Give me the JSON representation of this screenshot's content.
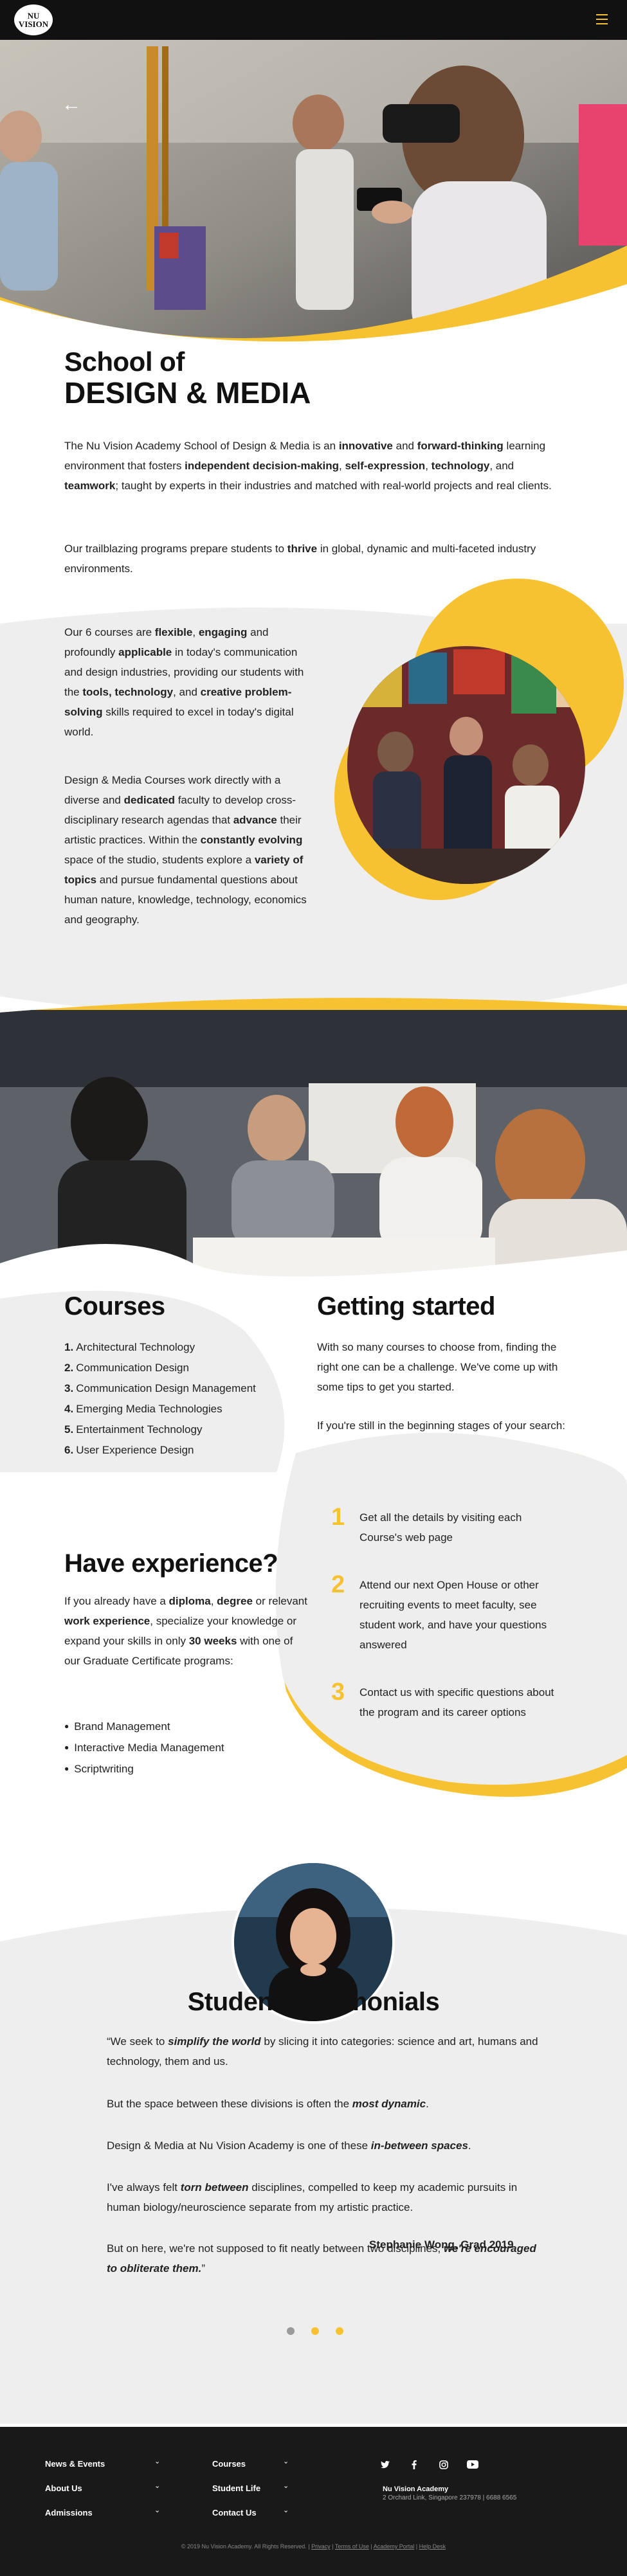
{
  "brand": {
    "logo_line1": "NU",
    "logo_line2": "VISION",
    "accent": "#f7c232",
    "dark": "#111111",
    "grey": "#eeeeee"
  },
  "header": {
    "menu_icon": "hamburger-icon"
  },
  "hero": {
    "back_icon": "arrow-left-icon",
    "back_glyph": "←"
  },
  "intro": {
    "title_line1": "School of",
    "title_line2": "DESIGN & MEDIA",
    "p1": {
      "a": "The Nu Vision Academy School of Design & Media is an ",
      "b": "innovative",
      "c": " and ",
      "d": "forward-thinking",
      "e": " learning environment that fosters ",
      "f": "independent decision-making",
      "g": ", ",
      "h": "self-expression",
      "i": ", ",
      "j": "technology",
      "k": ", and ",
      "l": "teamwork",
      "m": "; taught by experts in their industries and matched with real-world projects and real clients."
    },
    "p2": {
      "a": "Our trailblazing programs prepare students to ",
      "b": "thrive",
      "c": " in global, dynamic and multi-faceted industry environments."
    }
  },
  "features": {
    "p1": {
      "a": "Our 6 courses are ",
      "b": "flexible",
      "c": ", ",
      "d": "engaging",
      "e": " and profoundly ",
      "f": "applicable",
      "g": " in today's communication and design industries, providing our students with the ",
      "h": "tools, technology",
      "i": ", and ",
      "j": "creative problem-solving",
      "k": " skills required to excel in today's digital world."
    },
    "p2": {
      "a": "Design & Media Courses work directly with a diverse and ",
      "b": "dedicated",
      "c": " faculty to develop cross-disciplinary research agendas that ",
      "d": "advance",
      "e": " their artistic practices. Within the ",
      "f": "constantly evolving",
      "g": " space of the studio, students explore a ",
      "h": "variety of topics",
      "i": " and pursue fundamental questions about human nature, knowledge, technology, economics and geography."
    }
  },
  "courses": {
    "title": "Courses",
    "items": [
      {
        "num": "1.",
        "label": "Architectural Technology"
      },
      {
        "num": "2.",
        "label": "Communication Design"
      },
      {
        "num": "3.",
        "label": "Communication Design Management"
      },
      {
        "num": "4.",
        "label": "Emerging Media Technologies"
      },
      {
        "num": "5.",
        "label": "Entertainment Technology"
      },
      {
        "num": "6.",
        "label": "User Experience Design"
      }
    ]
  },
  "getting_started": {
    "title": "Getting started",
    "p1": "With so many courses to choose from, finding the right one can be a challenge. We've come up with some tips to get you started.",
    "p2": "If you're still in the beginning stages of your search:",
    "steps": [
      {
        "num": "1",
        "text": "Get all the details by visiting each Course's web page"
      },
      {
        "num": "2",
        "text": "Attend our next Open House or other recruiting events to meet faculty, see student work, and have your questions answered"
      },
      {
        "num": "3",
        "text": "Contact us with specific questions about the program and its career options"
      }
    ]
  },
  "experience": {
    "title": "Have experience?",
    "p": {
      "a": "If you already have a ",
      "b": "diploma",
      "c": ", ",
      "d": "degree",
      "e": " or relevant ",
      "f": "work experience",
      "g": ", specialize your knowledge or expand your skills in only ",
      "h": "30 weeks",
      "i": " with one of our Graduate Certificate programs:"
    },
    "items": [
      "Brand Management",
      "Interactive Media Management",
      "Scriptwriting"
    ]
  },
  "testimonials": {
    "title": "Student Testimonials",
    "q1": {
      "a": "“We seek to ",
      "b": "simplify the world",
      "c": " by slicing it into categories: science and art, humans and technology, them and us."
    },
    "q2": {
      "a": "But the space between these divisions is often the ",
      "b": "most dynamic",
      "c": "."
    },
    "q3": {
      "a": "Design & Media at Nu Vision Academy is one of these ",
      "b": "in-between spaces",
      "c": "."
    },
    "q4": {
      "a": "I've always felt ",
      "b": "torn between",
      "c": " disciplines, compelled to keep my academic pursuits in human biology/neuroscience separate from my artistic practice."
    },
    "q5": {
      "a": "But on here, we're not supposed to fit neatly between two disciplines, ",
      "b": "we're encouraged to obliterate them.",
      "c": "”"
    },
    "author": "Stephanie Wong, Grad 2019",
    "dots": [
      "#9a9a9a",
      "#f7c232",
      "#f7c232"
    ]
  },
  "footer": {
    "col1": [
      "News & Events",
      "About Us",
      "Admissions"
    ],
    "col2": [
      "Courses",
      "Student Life",
      "Contact Us"
    ],
    "chevron": "⌄",
    "social": [
      {
        "name": "twitter-icon",
        "glyph": "🐦"
      },
      {
        "name": "facebook-icon",
        "glyph": "f"
      },
      {
        "name": "instagram-icon",
        "glyph": "◎"
      },
      {
        "name": "youtube-icon",
        "glyph": "▶"
      }
    ],
    "address_title": "Nu Vision Academy",
    "address": "2 Orchard Link, Singapore 237978 | 6688 6565",
    "copyright": "© 2019 Nu Vision Academy. All Rights Reserved.",
    "links": [
      "Privacy",
      "Terms of Use",
      "Academy Portal",
      "Help Desk"
    ]
  }
}
